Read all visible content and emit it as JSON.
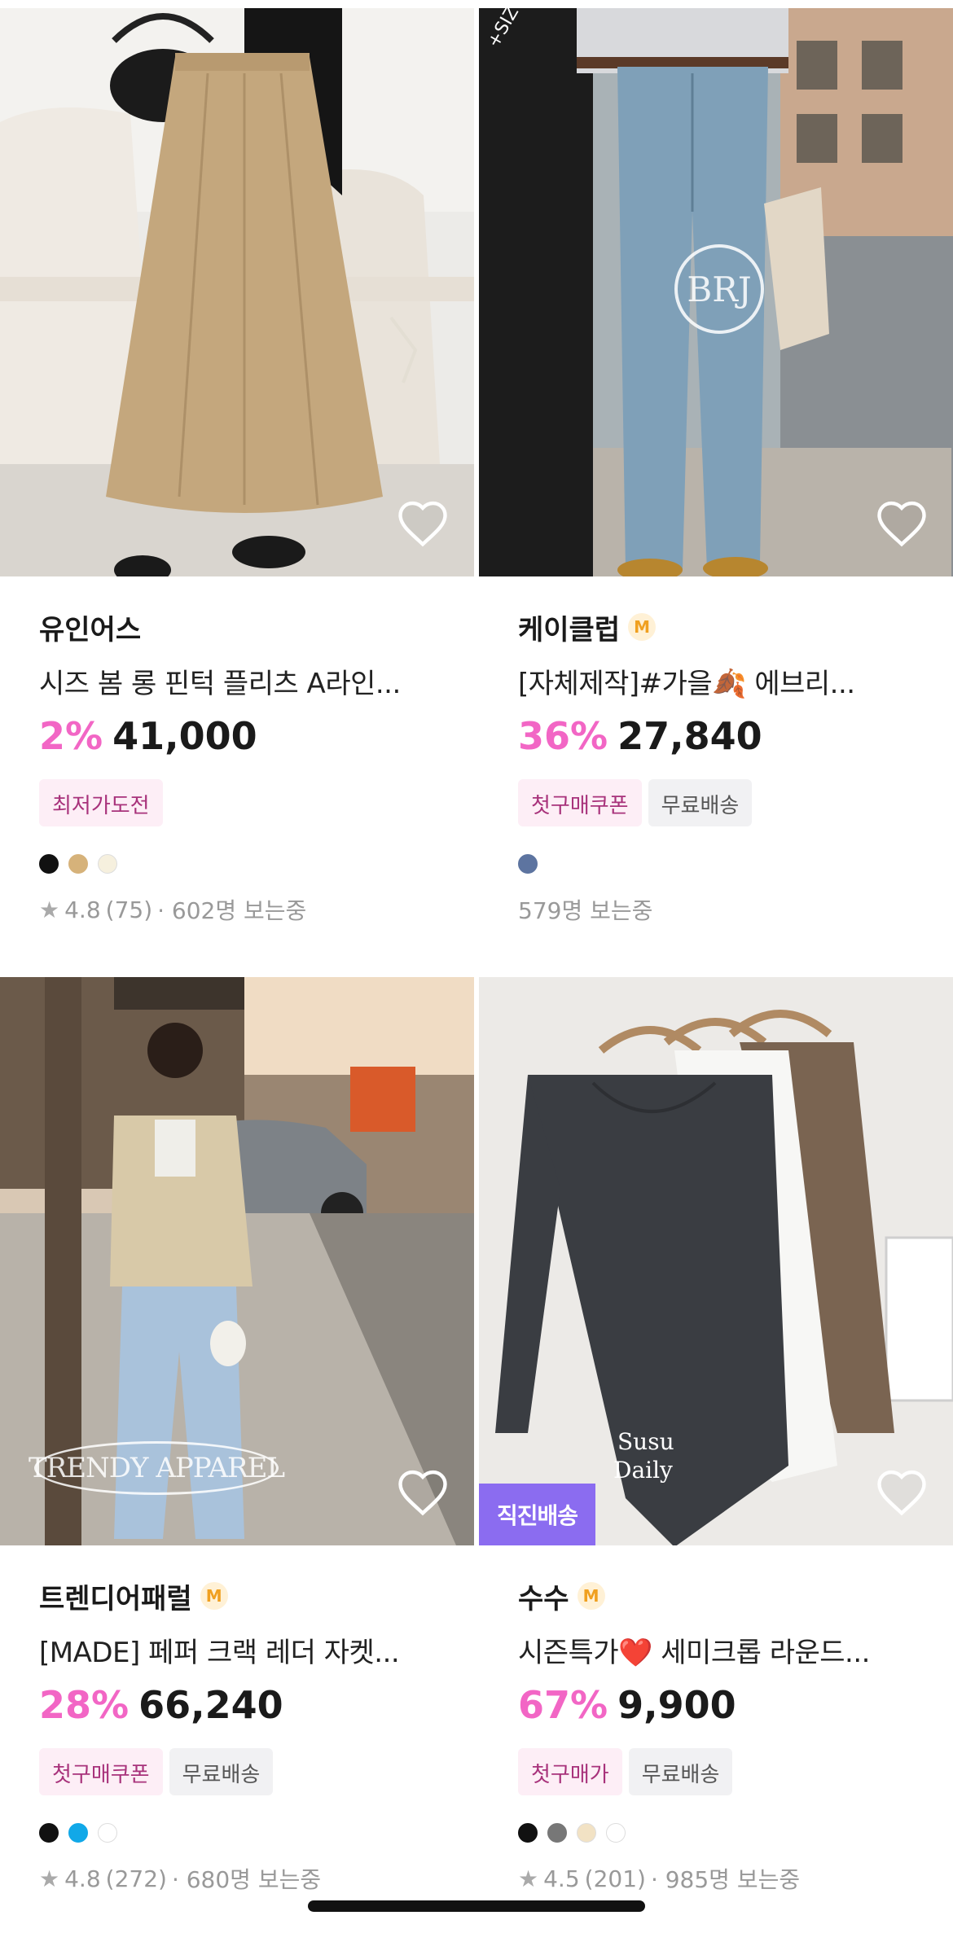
{
  "products": [
    {
      "seller": "유인어스",
      "seller_badge": "",
      "title": "시즈 봄 롱 핀턱 플리츠 A라인...",
      "discount": "2%",
      "price": "41,000",
      "tags": [
        {
          "label": "최저가도전",
          "style": "pink"
        }
      ],
      "colors": [
        "#111111",
        "#d6b27a",
        "#f6f0de"
      ],
      "rating": "4.8",
      "reviews": "(75)",
      "viewers": "· 602명 보는중",
      "watermark": "",
      "direct_badge": ""
    },
    {
      "seller": "케이클럽",
      "seller_badge": "M",
      "title": "[자체제작]#가을🍂 에브리...",
      "discount": "36%",
      "price": "27,840",
      "tags": [
        {
          "label": "첫구매쿠폰",
          "style": "pink"
        },
        {
          "label": "무료배송",
          "style": "gray"
        }
      ],
      "colors": [
        "#5d74a0"
      ],
      "rating": "",
      "reviews": "",
      "viewers": "579명 보는중",
      "watermark": "BRJ",
      "direct_badge": ""
    },
    {
      "seller": "트렌디어패럴",
      "seller_badge": "M",
      "title": "[MADE] 페퍼 크랙 레더 자켓...",
      "discount": "28%",
      "price": "66,240",
      "tags": [
        {
          "label": "첫구매쿠폰",
          "style": "pink"
        },
        {
          "label": "무료배송",
          "style": "gray"
        }
      ],
      "colors": [
        "#111111",
        "#11a8e8",
        "#ffffff"
      ],
      "rating": "4.8",
      "reviews": "(272)",
      "viewers": "· 680명 보는중",
      "watermark": "TRENDY APPAREL",
      "direct_badge": ""
    },
    {
      "seller": "수수",
      "seller_badge": "M",
      "title": "시즌특가❤️ 세미크롭 라운드...",
      "discount": "67%",
      "price": "9,900",
      "tags": [
        {
          "label": "첫구매가",
          "style": "pink"
        },
        {
          "label": "무료배송",
          "style": "gray"
        }
      ],
      "colors": [
        "#111111",
        "#777777",
        "#f2e2c4",
        "#ffffff"
      ],
      "rating": "4.5",
      "reviews": "(201)",
      "viewers": "· 985명 보는중",
      "watermark": "Susu Daily",
      "direct_badge": "직진배송"
    }
  ],
  "icons": {
    "wishlist": "heart-outline-icon",
    "rating": "star-icon"
  }
}
